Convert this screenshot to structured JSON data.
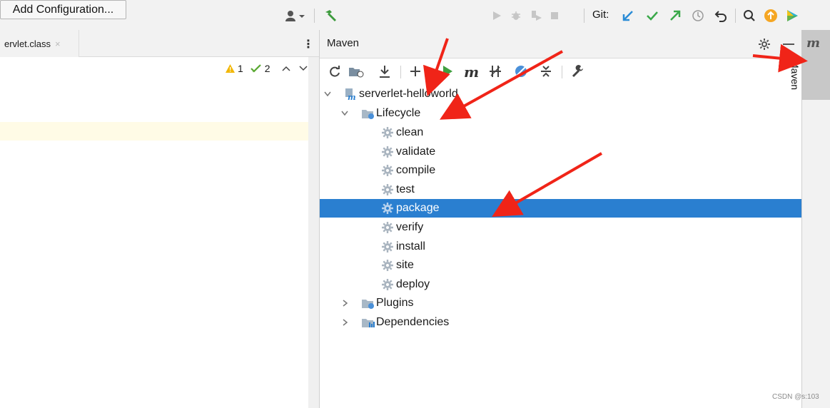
{
  "toolbar": {
    "add_configuration_label": "Add Configuration...",
    "git_label": "Git:",
    "icons": [
      "user-icon",
      "hammer-icon",
      "run-icon",
      "debug-icon",
      "coverage-icon",
      "stop-icon",
      "git-update-icon",
      "git-commit-icon",
      "git-push-icon",
      "history-icon",
      "rollback-icon",
      "search-icon",
      "update-icon",
      "toolbox-icon"
    ]
  },
  "editor": {
    "file_tab_label": "ervlet.class",
    "close_glyph": "×",
    "kebab_glyph": "⋮",
    "warning_count": "1",
    "check_count": "2"
  },
  "maven": {
    "title": "Maven",
    "tree": {
      "root": "serverlet-helloworld",
      "lifecycle": "Lifecycle",
      "phases": [
        "clean",
        "validate",
        "compile",
        "test",
        "package",
        "verify",
        "install",
        "site",
        "deploy"
      ],
      "selected_phase": "package",
      "plugins": "Plugins",
      "dependencies": "Dependencies"
    },
    "side_tab_label": "Maven",
    "side_tab_glyph": "m"
  },
  "colors": {
    "selection": "#2a7fd0",
    "accent_arrow": "#f02418",
    "run_green": "#3fa03f",
    "git_blue": "#2b8cd6",
    "git_green": "#3aa84a"
  },
  "watermark": "CSDN @s:103"
}
